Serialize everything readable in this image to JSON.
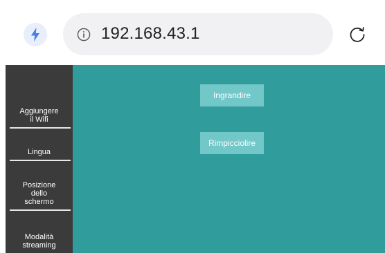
{
  "browser": {
    "url": "192.168.43.1"
  },
  "sidebar": {
    "items": [
      {
        "label": "Aggiungere\nil Wifi"
      },
      {
        "label": "Lingua"
      },
      {
        "label": "Posizione\ndello\nschermo"
      },
      {
        "label": "Modalità\nstreaming"
      }
    ]
  },
  "main": {
    "buttons": [
      {
        "label": "Ingrandire"
      },
      {
        "label": "Rimpicciolire"
      }
    ]
  },
  "colors": {
    "sidebar_bg": "#3b3b3b",
    "main_bg": "#309c9c",
    "button_bg": "#72c7c8",
    "bolt": "#4a7fe0"
  },
  "icons": {
    "bolt": "lightning-bolt-icon",
    "info": "info-icon",
    "reload": "reload-icon"
  }
}
